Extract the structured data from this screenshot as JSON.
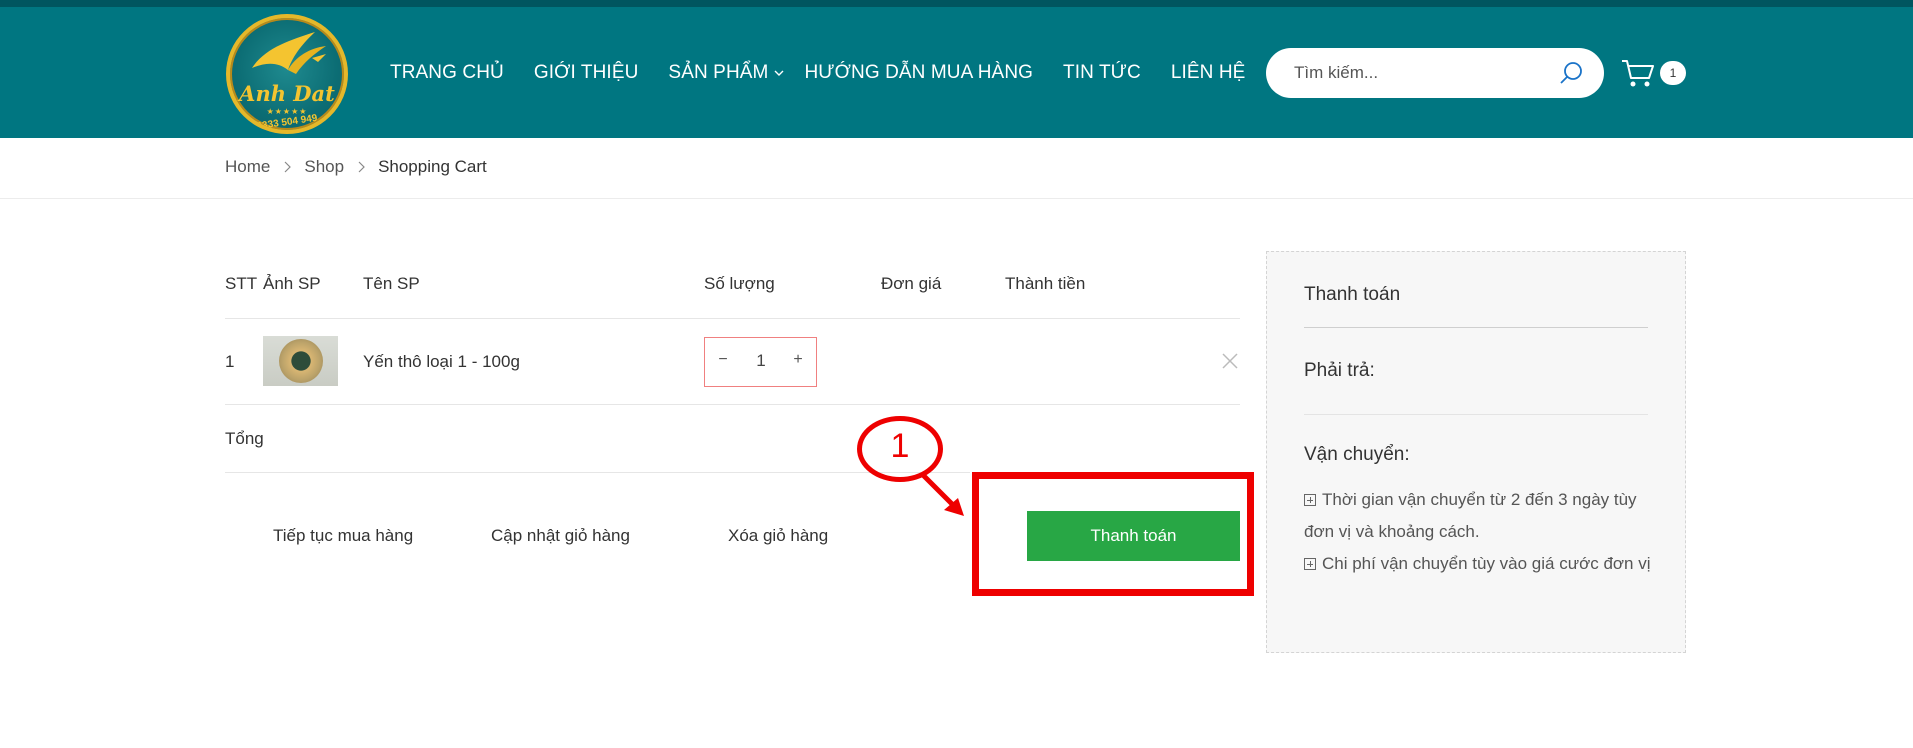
{
  "header": {
    "logo": {
      "brand_text": "Anh Dat",
      "phone": "0333 504 949",
      "stars": "★★★★★"
    },
    "nav": [
      {
        "label": "TRANG CHỦ"
      },
      {
        "label": "GIỚI THIỆU"
      },
      {
        "label": "SẢN PHẨM",
        "has_dropdown": true
      },
      {
        "label": "HƯỚNG DẪN MUA HÀNG"
      },
      {
        "label": "TIN TỨC"
      },
      {
        "label": "LIÊN HỆ"
      }
    ],
    "search": {
      "placeholder": "Tìm kiếm...",
      "icon": "search-icon"
    },
    "cart": {
      "icon": "cart-icon",
      "count": "1"
    },
    "colors": {
      "header_bg": "#007681",
      "accent": "#28a745"
    }
  },
  "breadcrumb": {
    "items": [
      "Home",
      "Shop"
    ],
    "current": "Shopping Cart"
  },
  "cart_table": {
    "headers": {
      "index": "STT",
      "image": "Ảnh SP",
      "name": "Tên SP",
      "quantity": "Số lượng",
      "unit_price": "Đơn giá",
      "subtotal": "Thành tiền"
    },
    "rows": [
      {
        "index": "1",
        "name": "Yến thô loại 1 - 100g",
        "quantity": "1",
        "minus": "−",
        "plus": "+"
      }
    ],
    "total_label": "Tổng"
  },
  "actions": {
    "continue": "Tiếp tục mua hàng",
    "update": "Cập nhật giỏ hàng",
    "clear": "Xóa giỏ hàng",
    "checkout": "Thanh toán"
  },
  "annotation": {
    "number": "1"
  },
  "sidebar": {
    "title": "Thanh toán",
    "pay_label": "Phải trả:",
    "shipping_label": "Vận chuyển:",
    "notes": [
      "Thời gian vận chuyển từ 2 đến 3 ngày tùy đơn vị và khoảng cách.",
      "Chi phí vận chuyển tùy vào giá cước đơn vị"
    ]
  }
}
